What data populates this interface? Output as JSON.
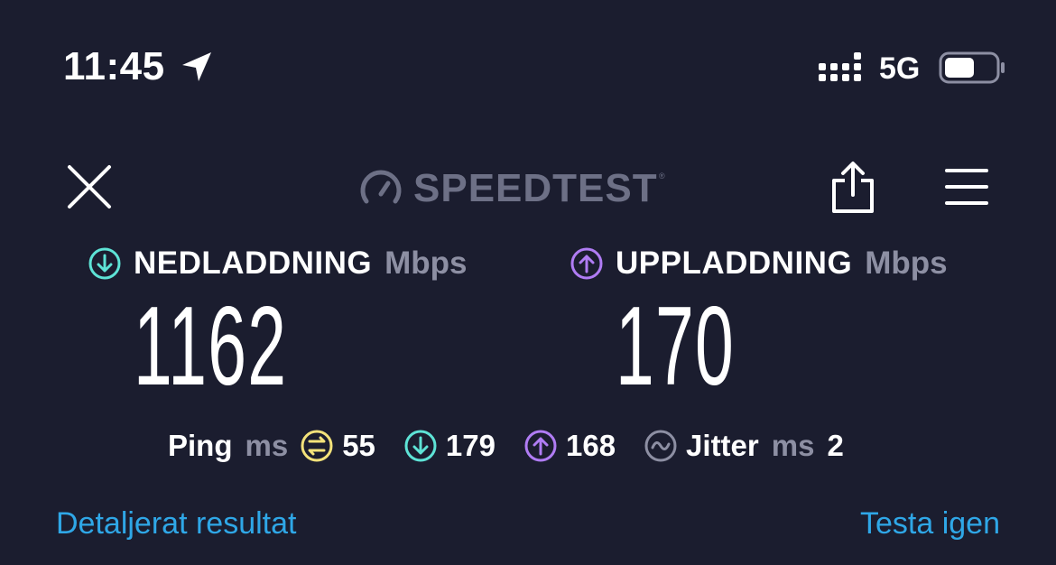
{
  "status_bar": {
    "time": "11:45",
    "network": "5G",
    "battery_level": 0.6
  },
  "header": {
    "brand": "SPEEDTEST",
    "trademark": "®"
  },
  "download": {
    "label": "NEDLADDNING",
    "unit": "Mbps",
    "value": "1162",
    "color": "#5ee3d6"
  },
  "upload": {
    "label": "UPPLADDNING",
    "unit": "Mbps",
    "value": "170",
    "color": "#b07cf4"
  },
  "ping": {
    "label": "Ping",
    "unit": "ms",
    "idle": "55",
    "download": "179",
    "upload": "168",
    "jitter_label": "Jitter",
    "jitter_unit": "ms",
    "jitter": "2",
    "idle_color": "#f3e27a"
  },
  "footer": {
    "details_link": "Detaljerat resultat",
    "retry_link": "Testa igen"
  },
  "icons": [
    "location-arrow-icon",
    "signal-icon",
    "battery-icon",
    "close-icon",
    "speedometer-icon",
    "share-icon",
    "menu-icon",
    "download-arrow-icon",
    "upload-arrow-icon",
    "idle-ping-icon",
    "jitter-icon"
  ]
}
